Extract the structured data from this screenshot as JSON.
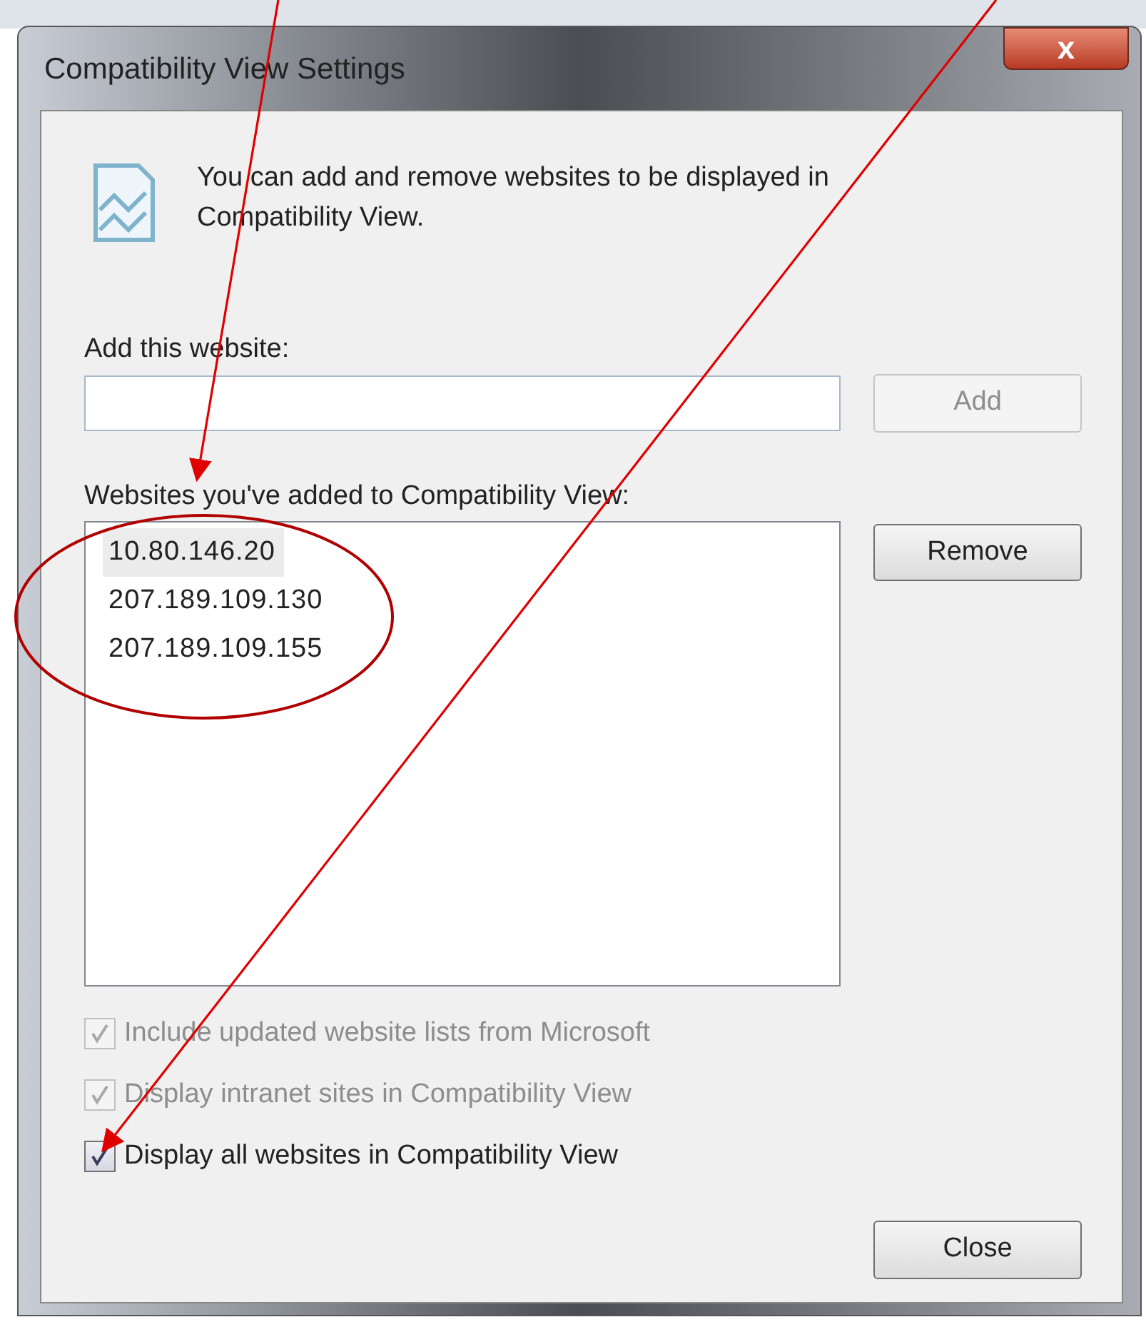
{
  "window": {
    "title": "Compatibility View Settings",
    "close_glyph": "x"
  },
  "intro": "You can add and remove websites to be displayed in Compatibility View.",
  "add_field": {
    "label": "Add this website:"
  },
  "add_button": {
    "label": "Add",
    "disabled": true
  },
  "list": {
    "label": "Websites you've added to Compatibility View:",
    "items": [
      {
        "text": "10.80.146.20",
        "selected": true
      },
      {
        "text": "207.189.109.130",
        "selected": false
      },
      {
        "text": "207.189.109.155",
        "selected": false
      }
    ]
  },
  "remove_button": {
    "label": "Remove",
    "disabled": false
  },
  "checkboxes": [
    {
      "label": "Include updated website lists from Microsoft",
      "checked": true,
      "disabled": true
    },
    {
      "label": "Display intranet sites in Compatibility View",
      "checked": true,
      "disabled": true
    },
    {
      "label": "Display all websites in Compatibility View",
      "checked": true,
      "disabled": false
    }
  ],
  "close_button": {
    "label": "Close",
    "disabled": false
  }
}
